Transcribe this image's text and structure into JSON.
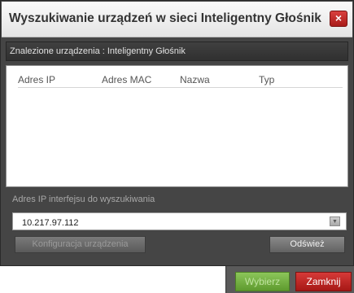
{
  "dialog": {
    "title": "Wyszukiwanie urządzeń w sieci Inteligentny Głośnik",
    "close_glyph": "×",
    "close_icon": "close-icon",
    "found_text": "Znalezione urządzenia : Inteligentny Głośnik"
  },
  "device_list": {
    "columns": [
      "Adres IP",
      "Adres MAC",
      "Nazwa",
      "Typ"
    ],
    "rows": []
  },
  "interface": {
    "label": "Adres IP interfejsu do wyszukiwania",
    "selected_ip": "10.217.97.112",
    "dropdown_glyph": "▼",
    "dropdown_icon": "chevron-down-icon"
  },
  "buttons": {
    "config": "Konfiguracja urządzenia",
    "refresh": "Odśwież",
    "select": "Wybierz",
    "close": "Zamknij"
  },
  "colors": {
    "close_accent": "#c62828",
    "select_green": "#76b043",
    "panel_dark": "#454545"
  }
}
